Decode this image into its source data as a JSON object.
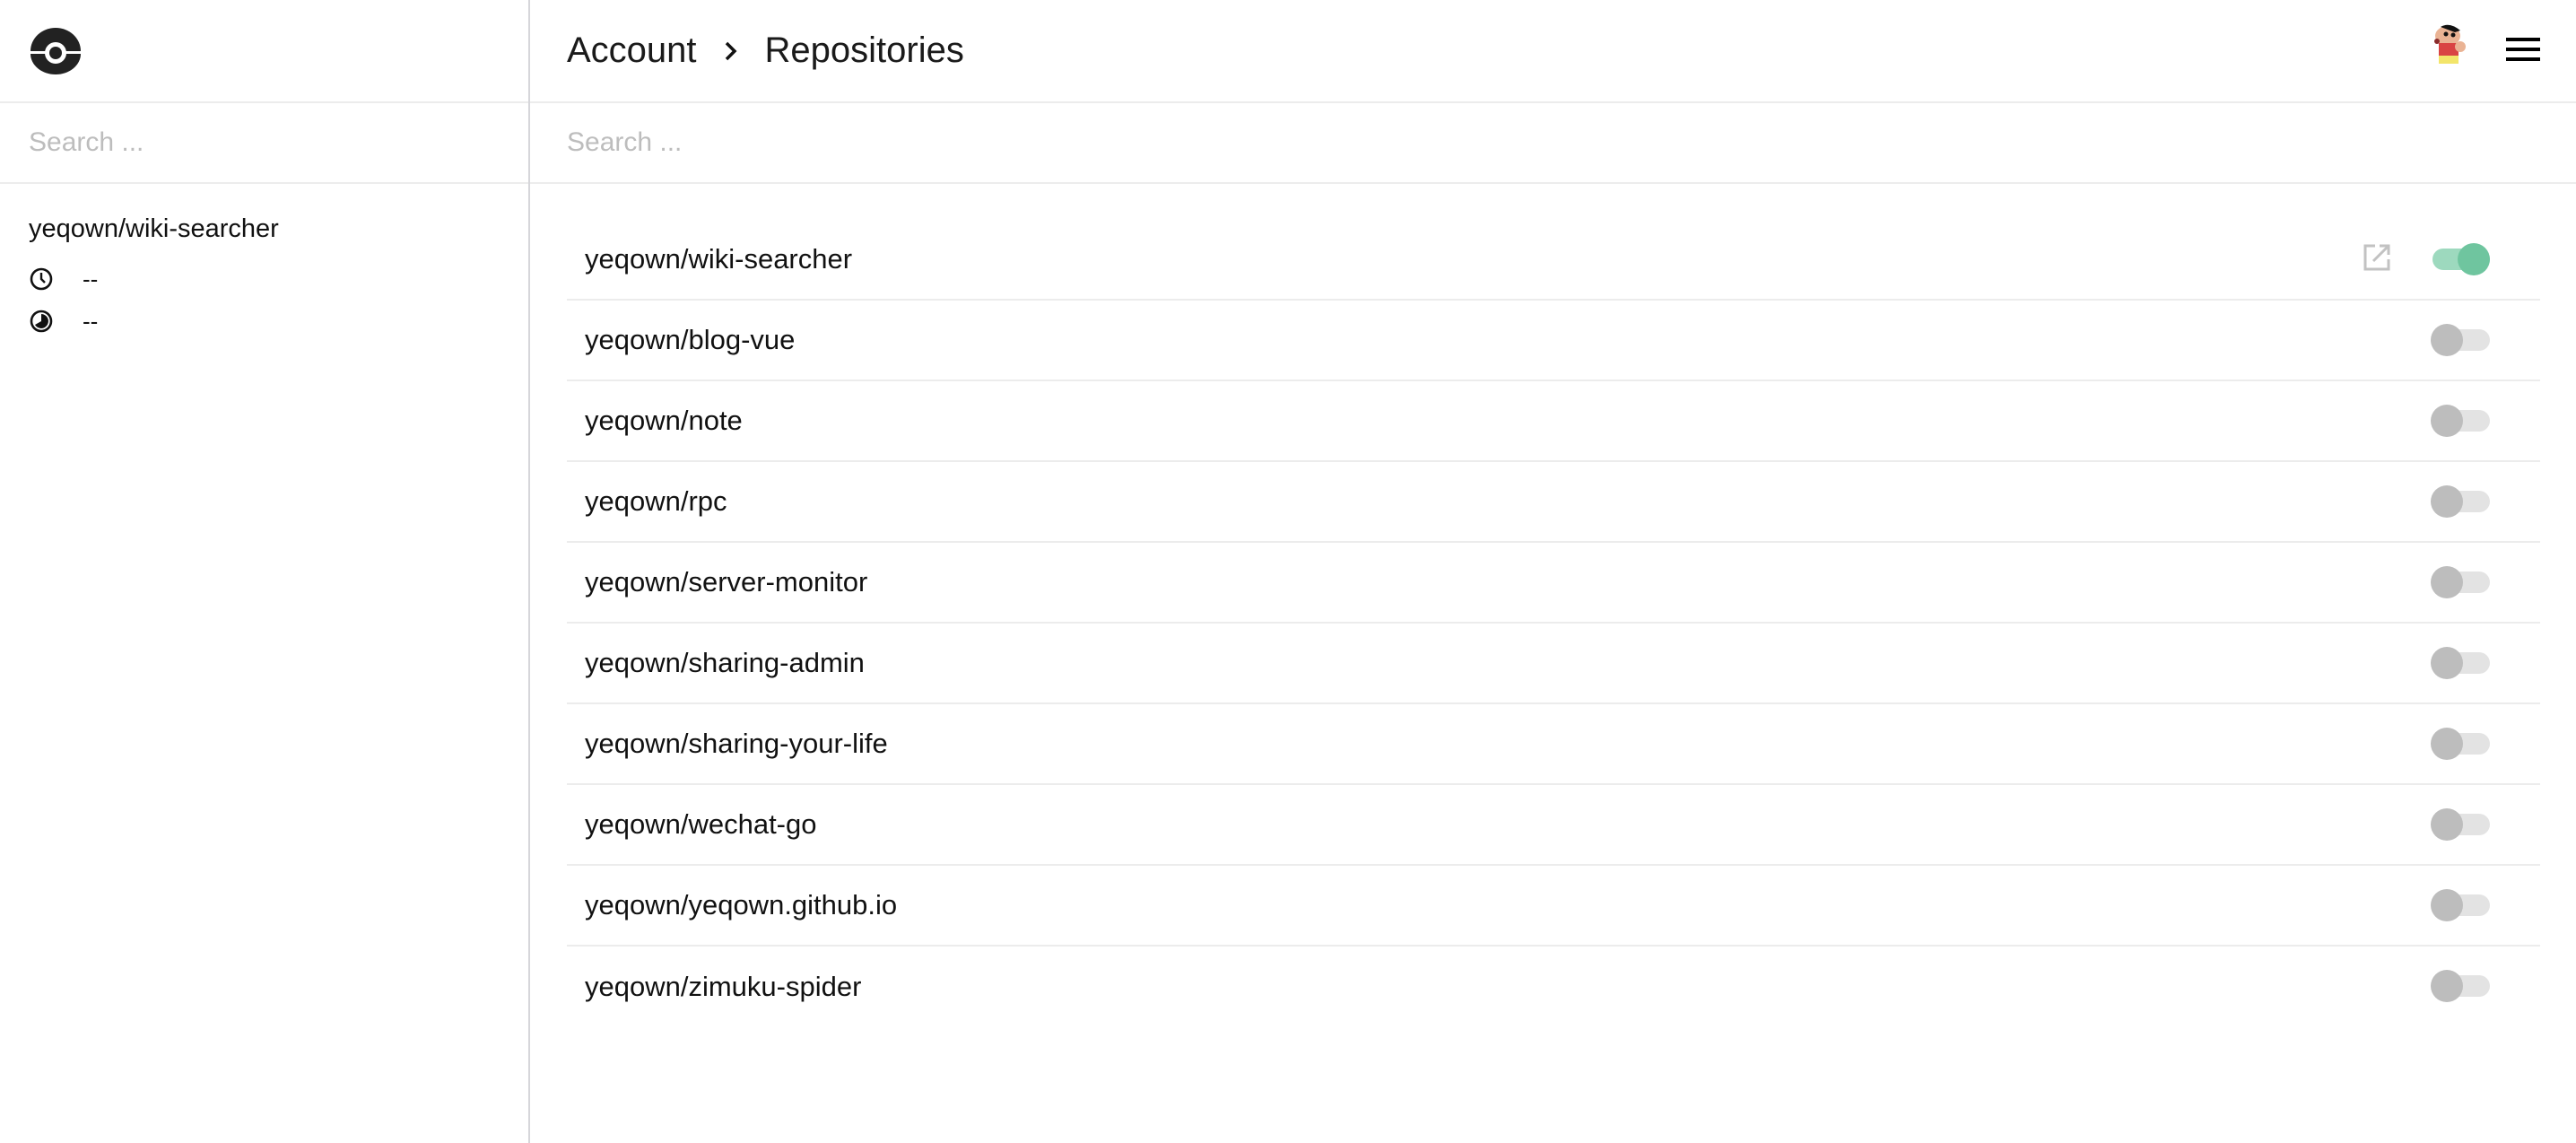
{
  "sidebar": {
    "logo": "drone-logo",
    "search_placeholder": "Search ...",
    "repo": {
      "name": "yeqown/wiki-searcher",
      "last_build_time": "--",
      "duration": "--"
    }
  },
  "header": {
    "breadcrumb": [
      "Account",
      "Repositories"
    ],
    "avatar": "user-avatar",
    "menu_icon": "hamburger-menu-icon"
  },
  "main": {
    "search_placeholder": "Search ...",
    "repos": [
      {
        "name": "yeqown/wiki-searcher",
        "active": true
      },
      {
        "name": "yeqown/blog-vue",
        "active": false
      },
      {
        "name": "yeqown/note",
        "active": false
      },
      {
        "name": "yeqown/rpc",
        "active": false
      },
      {
        "name": "yeqown/server-monitor",
        "active": false
      },
      {
        "name": "yeqown/sharing-admin",
        "active": false
      },
      {
        "name": "yeqown/sharing-your-life",
        "active": false
      },
      {
        "name": "yeqown/wechat-go",
        "active": false
      },
      {
        "name": "yeqown/yeqown.github.io",
        "active": false
      },
      {
        "name": "yeqown/zimuku-spider",
        "active": false
      }
    ]
  },
  "colors": {
    "toggle_on": "#6fc59f",
    "toggle_on_track": "#9dd9be",
    "toggle_off": "#bdbdbd",
    "toggle_off_track": "#e3e3e3"
  }
}
